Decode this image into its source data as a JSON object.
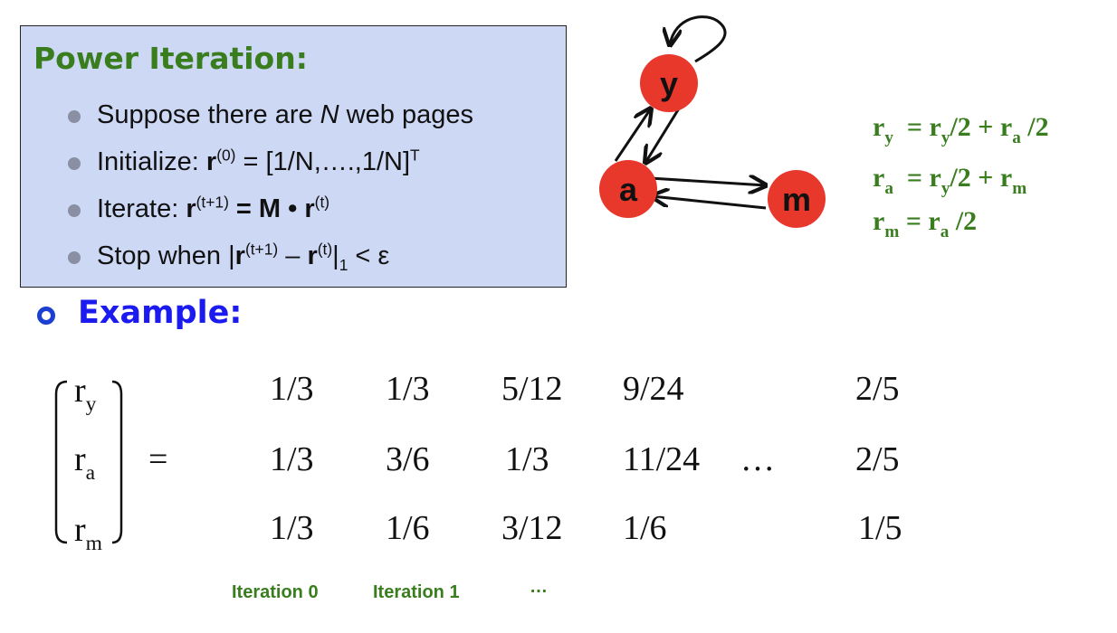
{
  "power_iteration": {
    "title": "Power Iteration:",
    "steps": [
      {
        "text_a": "Suppose there are ",
        "text_b": "N",
        "text_c": " web pages"
      },
      {
        "prefix": "Initialize: ",
        "r": "r",
        "sup": "(0)",
        "rest": " = [1/N,….,1/N]",
        "sup2": "T"
      },
      {
        "prefix": "Iterate: ",
        "r": "r",
        "sup": "(t+1)",
        "mid": " = M • ",
        "r2": "r",
        "sup2": "(t)"
      },
      {
        "prefix": "Stop when |",
        "r": "r",
        "sup": "(t+1)",
        "mid": " – ",
        "r2": "r",
        "sup2": "(t)",
        "after": "|",
        "sub": "1",
        "rest": " < ε"
      }
    ]
  },
  "graph": {
    "nodes": [
      {
        "id": "y",
        "label": "y"
      },
      {
        "id": "a",
        "label": "a"
      },
      {
        "id": "m",
        "label": "m"
      }
    ],
    "node_color": "#e8372b",
    "edges": [
      [
        "y",
        "y"
      ],
      [
        "y",
        "a"
      ],
      [
        "a",
        "y"
      ],
      [
        "a",
        "m"
      ],
      [
        "m",
        "a"
      ]
    ]
  },
  "equations": [
    {
      "lhs": "r",
      "lhs_sub": "y",
      "rhs": [
        {
          "t": "= r"
        },
        {
          "s": "y"
        },
        {
          "t": "/2 + r"
        },
        {
          "s": "a"
        },
        {
          "t": " /2"
        }
      ]
    },
    {
      "lhs": "r",
      "lhs_sub": "a",
      "rhs": [
        {
          "t": "= r"
        },
        {
          "s": "y"
        },
        {
          "t": "/2 + r"
        },
        {
          "s": "m"
        }
      ]
    },
    {
      "lhs": "r",
      "lhs_sub": "m",
      "rhs": [
        {
          "t": "= r"
        },
        {
          "s": "a"
        },
        {
          "t": " /2"
        }
      ]
    }
  ],
  "example": {
    "title": "Example:",
    "vector": [
      {
        "r": "r",
        "sub": "y"
      },
      {
        "r": "r",
        "sub": "a"
      },
      {
        "r": "r",
        "sub": "m"
      }
    ],
    "equals": "=",
    "columns": [
      [
        "1/3",
        "1/3",
        "1/3"
      ],
      [
        "1/3",
        "3/6",
        "1/6"
      ],
      [
        "5/12",
        "1/3",
        "3/12"
      ],
      [
        "9/24",
        "11/24",
        "1/6"
      ],
      [
        "2/5",
        "2/5",
        "1/5"
      ]
    ],
    "ellipsis": "…",
    "iteration_labels": [
      "Iteration 0",
      "Iteration 1",
      "…"
    ]
  },
  "colors": {
    "accent_green": "#3a7d1f",
    "heading_blue": "#1b1bf0",
    "box_fill": "#cdd8f5"
  }
}
